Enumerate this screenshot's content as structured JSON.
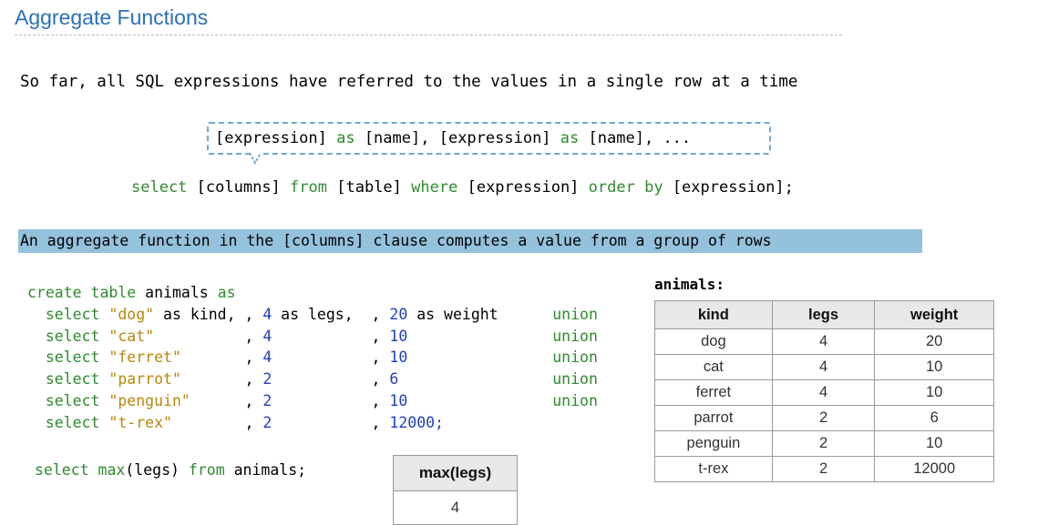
{
  "title": "Aggregate Functions",
  "intro": "So far, all SQL expressions have referred to the values in a single row at a time",
  "callout": {
    "expr1": "[expression]",
    "as1": "as",
    "name1": "[name],",
    "expr2": "[expression]",
    "as2": "as",
    "name2": "[name],",
    "ellipsis": "..."
  },
  "select_template": {
    "select_kw": "select",
    "columns": "[columns]",
    "from_kw": "from",
    "table": "[table]",
    "where_kw": "where",
    "expression1": "[expression]",
    "order_kw": "order by",
    "expression2": "[expression];"
  },
  "highlight": "An aggregate function in the [columns] clause computes a value from a group of rows",
  "code": {
    "create_kw": "create table",
    "table_name": "animals",
    "as_kw": "as",
    "rows": [
      {
        "sel": "select",
        "kind": "\"dog\"",
        "kind_as": " as kind,",
        "legs": "4",
        "legs_as": " as legs,",
        "weight": "20",
        "weight_as": " as weight",
        "tail": "union"
      },
      {
        "sel": "select",
        "kind": "\"cat\"",
        "kind_as": "",
        "legs": "4",
        "legs_as": "",
        "weight": "10",
        "weight_as": "",
        "tail": "union"
      },
      {
        "sel": "select",
        "kind": "\"ferret\"",
        "kind_as": "",
        "legs": "4",
        "legs_as": "",
        "weight": "10",
        "weight_as": "",
        "tail": "union"
      },
      {
        "sel": "select",
        "kind": "\"parrot\"",
        "kind_as": "",
        "legs": "2",
        "legs_as": "",
        "weight": "6",
        "weight_as": "",
        "tail": "union"
      },
      {
        "sel": "select",
        "kind": "\"penguin\"",
        "kind_as": "",
        "legs": "2",
        "legs_as": "",
        "weight": "10",
        "weight_as": "",
        "tail": "union"
      },
      {
        "sel": "select",
        "kind": "\"t-rex\"",
        "kind_as": "",
        "legs": "2",
        "legs_as": "",
        "weight": "12000;",
        "weight_as": "",
        "tail": ""
      }
    ]
  },
  "query": {
    "select_kw": "select",
    "func": "max",
    "arg": "(legs)",
    "from_kw": "from",
    "table": "animals;"
  },
  "max_table": {
    "header": "max(legs)",
    "value": "4"
  },
  "animals_table": {
    "label": "animals:",
    "headers": [
      "kind",
      "legs",
      "weight"
    ],
    "rows": [
      [
        "dog",
        "4",
        "20"
      ],
      [
        "cat",
        "4",
        "10"
      ],
      [
        "ferret",
        "4",
        "10"
      ],
      [
        "parrot",
        "2",
        "6"
      ],
      [
        "penguin",
        "2",
        "10"
      ],
      [
        "t-rex",
        "2",
        "12000"
      ]
    ]
  },
  "colors": {
    "title": "#2a6fb8",
    "keyword": "#2e8b2e",
    "number": "#1f3fbf",
    "string": "#b8860b",
    "highlight": "#94c1dc",
    "callout_border": "#6fa8cf"
  }
}
